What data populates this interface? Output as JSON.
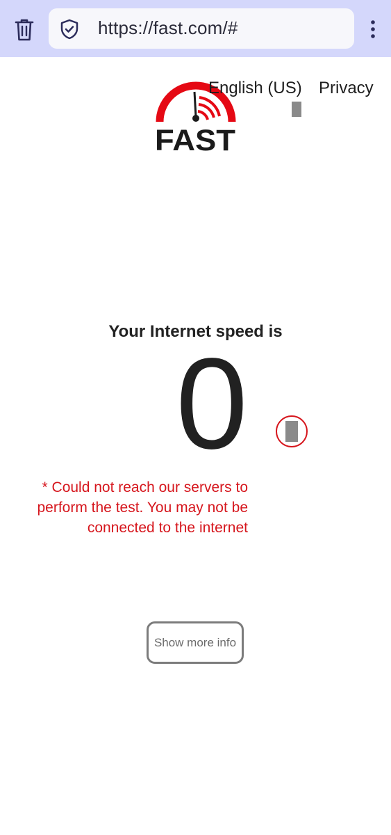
{
  "browser": {
    "url": "https://fast.com/#",
    "delete_icon": "trash-icon",
    "security_icon": "shield-check-icon",
    "menu_icon": "more-vert-icon",
    "toolbar_color": "#d4d7fb"
  },
  "header": {
    "logo_text": "FAST",
    "language_link": "English (US)",
    "privacy_link": "Privacy"
  },
  "speed": {
    "label": "Your Internet speed is",
    "value": "0",
    "units_icon": "loading-indicator-icon"
  },
  "error": {
    "message": "* Could not reach our servers to perform the test. You may not be connected to the internet",
    "color": "#d6161d"
  },
  "actions": {
    "show_more_info": "Show more info"
  },
  "brand": {
    "accent": "#e50914",
    "text": "#1b1b1b"
  }
}
